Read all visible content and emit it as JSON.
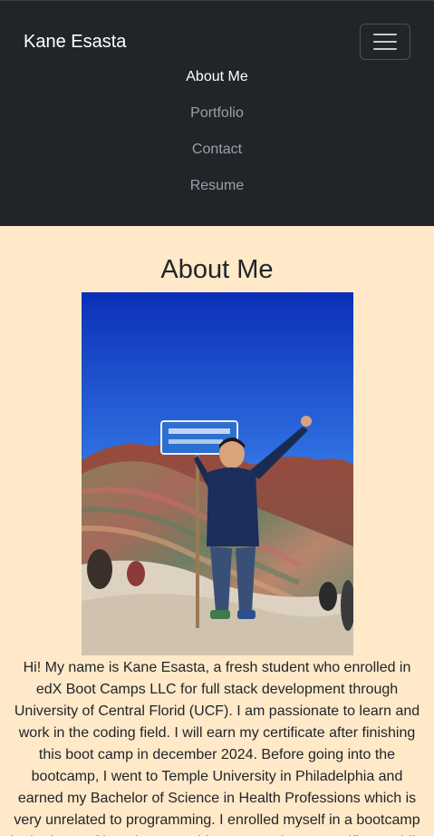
{
  "navbar": {
    "brand": "Kane Esasta",
    "links": [
      {
        "label": "About Me",
        "active": true
      },
      {
        "label": "Portfolio",
        "active": false
      },
      {
        "label": "Contact",
        "active": false
      },
      {
        "label": "Resume",
        "active": false
      }
    ],
    "toggler_icon": "hamburger-menu-icon"
  },
  "about": {
    "heading": "About Me",
    "photo_icon": "profile-photo-rainbow-mountain",
    "bio": "Hi! My name is Kane Esasta, a fresh student who enrolled in edX Boot Camps LLC for full stack development through University of Central Florid (UCF). I am passionate to learn and work in the coding field. I will earn my certificate after finishing this boot camp in december 2024. Before going into the bootcamp, I went to Temple University in Philadelphia and earned my Bachelor of Science in Health Professions which is very unrelated to programming. I enrolled myself in a bootcamp in the hope of learning something new and get a certificate while"
  },
  "colors": {
    "navbar_bg": "#212529",
    "page_bg": "#ffe9c9",
    "link_active": "#ffffff",
    "link_inactive": "#9aa0a6"
  }
}
